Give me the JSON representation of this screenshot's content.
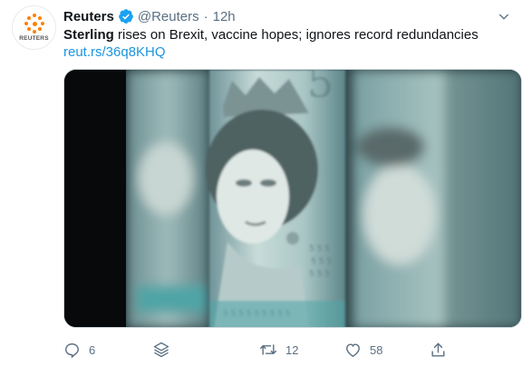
{
  "tweet": {
    "author_name": "Reuters",
    "handle": "@Reuters",
    "separator": "·",
    "time": "12h",
    "text_bold": "Sterling",
    "text_rest": " rises on Brexit, vaccine hopes; ignores record redundancies",
    "link": "reut.rs/36q8KHQ"
  },
  "avatar": {
    "logo_text": "REUTERS"
  },
  "actions": {
    "reply_count": "6",
    "retweet_count": "12",
    "like_count": "58"
  },
  "colors": {
    "link": "#1b95e0",
    "secondary": "#5b7083",
    "verified": "#1da1f2",
    "logo": "#ff8000"
  }
}
